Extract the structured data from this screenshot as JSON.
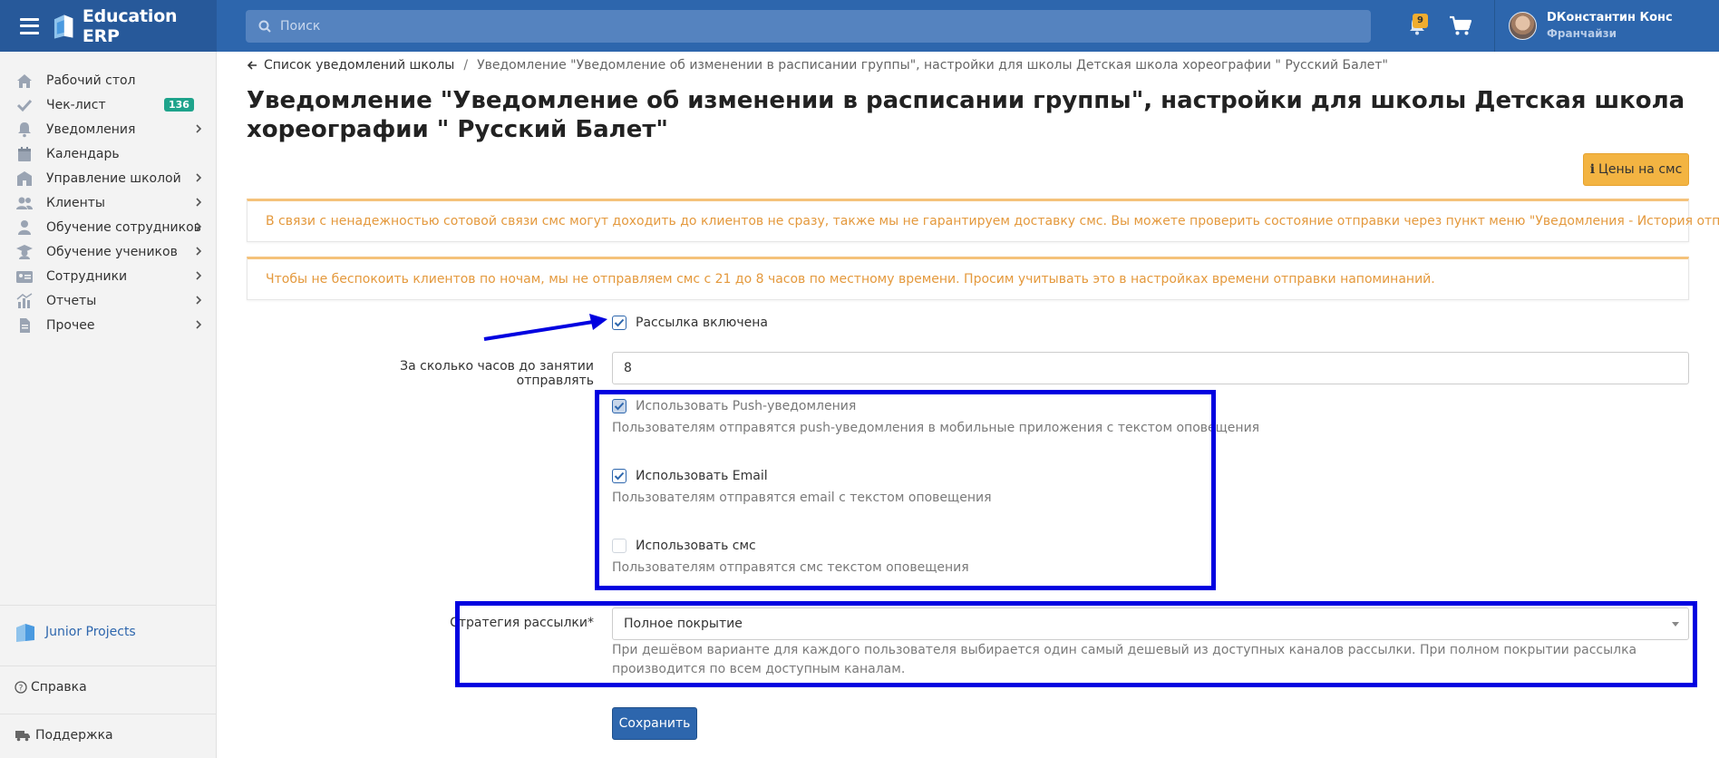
{
  "app": {
    "brand": "Education ERP",
    "search_placeholder": "Поиск",
    "notifications_count": "9",
    "user_name": "DКонстантин Конс...",
    "user_role": "Франчайзи"
  },
  "sidebar": {
    "items": [
      {
        "label": "Рабочий стол",
        "icon": "home-icon"
      },
      {
        "label": "Чек-лист",
        "icon": "check-icon",
        "badge": "136"
      },
      {
        "label": "Уведомления",
        "icon": "bell-icon"
      },
      {
        "label": "Календарь",
        "icon": "calendar-icon"
      },
      {
        "label": "Управление школой",
        "icon": "school-icon"
      },
      {
        "label": "Клиенты",
        "icon": "users-icon"
      },
      {
        "label": "Обучение сотрудников",
        "icon": "teacher-icon"
      },
      {
        "label": "Обучение учеников",
        "icon": "graduation-icon"
      },
      {
        "label": "Сотрудники",
        "icon": "id-card-icon"
      },
      {
        "label": "Отчеты",
        "icon": "chart-icon"
      },
      {
        "label": "Прочее",
        "icon": "file-icon"
      }
    ],
    "junior": "Junior Projects",
    "help": "Справка",
    "support": "Поддержка"
  },
  "breadcrumb": {
    "back": "Список уведомлений школы",
    "current": "Уведомление \"Уведомление об изменении в расписании группы\", настройки для школы Детская школа хореографии \" Русский Балет\""
  },
  "page": {
    "title": "Уведомление \"Уведомление об изменении в расписании группы\", настройки для школы Детская школа хореографии \" Русский Балет\"",
    "sms_prices_button": "Цены на смс",
    "alert_delivery": "В связи с ненадежностью сотовой связи смс могут доходить до клиентов не сразу, также мы не гарантируем доставку смс. Вы можете проверить состояние отправки через пункт меню \"Уведомления - История отправки смс\"",
    "alert_night": "Чтобы не беспокоить клиентов по ночам, мы не отправляем смс с 21 до 8 часов по местному времени. Просим учитывать это в настройках времени отправки напоминаний."
  },
  "form": {
    "mailing_enabled": {
      "label": "Рассылка включена",
      "checked": true
    },
    "hours_before": {
      "label": "За сколько часов до занятии отправлять",
      "value": "8"
    },
    "push": {
      "label": "Использовать Push-уведомления",
      "hint": "Пользователям отправятся push-уведомления в мобильные приложения с текстом оповещения",
      "checked": true
    },
    "email": {
      "label": "Использовать Email",
      "hint": "Пользователям отправятся email с текстом оповещения",
      "checked": true
    },
    "sms": {
      "label": "Использовать смс",
      "hint": "Пользователям отправятся смс текстом оповещения",
      "checked": false
    },
    "strategy": {
      "label": "Стратегия рассылки*",
      "value": "Полное покрытие",
      "hint": "При дешёвом варианте для каждого пользователя выбирается один самый дешевый из доступных каналов рассылки. При полном покрытии рассылка производится по всем доступным каналам."
    },
    "save_label": "Сохранить"
  },
  "colors": {
    "primary": "#2d66ad",
    "warning": "#f3b442",
    "alert_text": "#e4993d",
    "annotation": "#0000e0"
  }
}
